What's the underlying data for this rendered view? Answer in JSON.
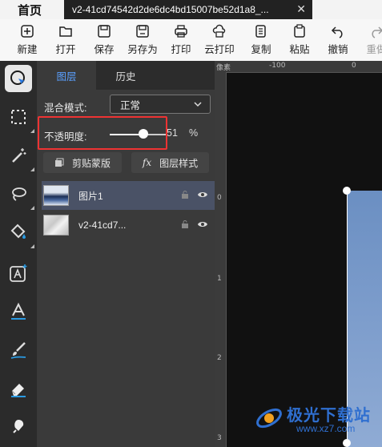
{
  "tabs": {
    "home": "首页",
    "document": "v2-41cd74542d2de6dc4bd15007be52d1a8_...",
    "close": "✕"
  },
  "toolbar": [
    {
      "label": "新建",
      "icon": "new-file-icon"
    },
    {
      "label": "打开",
      "icon": "folder-open-icon"
    },
    {
      "label": "保存",
      "icon": "save-icon"
    },
    {
      "label": "另存为",
      "icon": "save-as-icon"
    },
    {
      "label": "打印",
      "icon": "print-icon"
    },
    {
      "label": "云打印",
      "icon": "cloud-print-icon"
    },
    {
      "label": "复制",
      "icon": "copy-icon"
    },
    {
      "label": "粘贴",
      "icon": "paste-icon"
    },
    {
      "label": "撤销",
      "icon": "undo-icon"
    },
    {
      "label": "重做",
      "icon": "redo-icon"
    }
  ],
  "tools": [
    "smart-select-icon",
    "marquee-icon",
    "magic-wand-icon",
    "lasso-icon",
    "paint-bucket-icon",
    "add-text-icon",
    "text-style-icon",
    "brush-icon",
    "eraser-icon",
    "clone-stamp-icon"
  ],
  "panel": {
    "tabs": [
      "图层",
      "历史"
    ],
    "active_tab": 0,
    "blend_label": "混合模式:",
    "blend_value": "正常",
    "opacity_label": "不透明度:",
    "opacity_value": "51",
    "opacity_unit": "%",
    "opacity_fraction": 0.6,
    "clip_button": "剪贴蒙版",
    "style_button_icon": "fx",
    "style_button": "图层样式",
    "layers": [
      {
        "name": "图片1",
        "selected": true
      },
      {
        "name": "v2-41cd7...",
        "selected": false
      }
    ]
  },
  "ruler": {
    "top_label": "像素",
    "top_ticks": [
      "-100",
      "0"
    ],
    "left_ticks": [
      "0",
      "1",
      "2",
      "3"
    ]
  },
  "watermark": {
    "title": "极光下载站",
    "url": "www.xz7.com"
  },
  "colors": {
    "accent": "#5aa0ff",
    "highlight": "#e33333",
    "selected_layer": "#4a5266"
  }
}
